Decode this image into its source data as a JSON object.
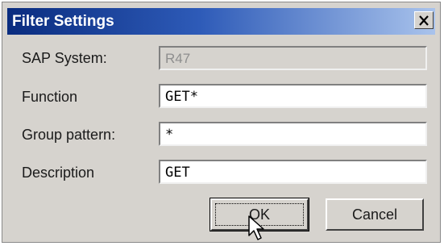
{
  "dialog": {
    "title": "Filter Settings",
    "close_symbol": "×"
  },
  "fields": [
    {
      "label": "SAP System:",
      "value": "R47",
      "enabled": false
    },
    {
      "label": "Function",
      "value": "GET*",
      "enabled": true
    },
    {
      "label": "Group pattern:",
      "value": "*",
      "enabled": true
    },
    {
      "label": "Description",
      "value": "GET",
      "enabled": true
    }
  ],
  "buttons": {
    "ok_label": "OK",
    "cancel_label": "Cancel"
  },
  "icons": {
    "close": "close-icon",
    "cursor": "arrow-cursor-icon"
  },
  "colors": {
    "title_bar_start": "#0a2c7f",
    "title_bar_end": "#a9c3ec",
    "dialog_face": "#d6d3ce"
  }
}
